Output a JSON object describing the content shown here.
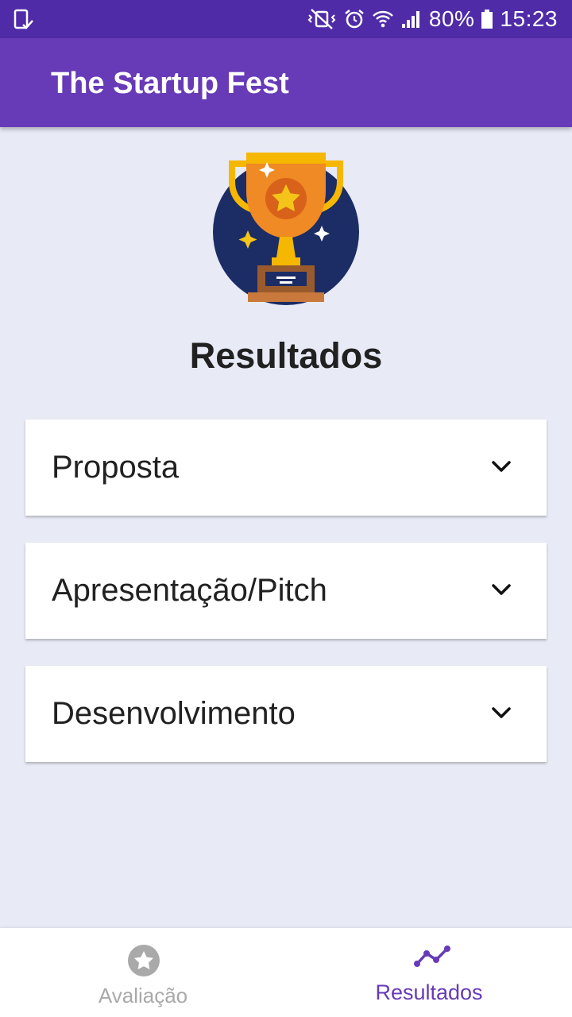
{
  "status_bar": {
    "left_icon": "screenshot-icon",
    "right_icons": [
      "vibrate-mute-icon",
      "alarm-icon",
      "wifi-icon",
      "signal-icon",
      "battery-icon"
    ],
    "battery": "80%",
    "time": "15:23"
  },
  "app_bar": {
    "title": "The Startup Fest"
  },
  "hero": {
    "icon": "trophy-icon"
  },
  "page": {
    "title": "Resultados",
    "sections": [
      {
        "label": "Proposta",
        "icon": "chevron-down-icon",
        "expanded": false
      },
      {
        "label": "Apresentação/Pitch",
        "icon": "chevron-down-icon",
        "expanded": false
      },
      {
        "label": "Desenvolvimento",
        "icon": "chevron-down-icon",
        "expanded": false
      }
    ]
  },
  "bottom_nav": {
    "items": [
      {
        "label": "Avaliação",
        "icon": "star-icon",
        "active": false
      },
      {
        "label": "Resultados",
        "icon": "trend-line-icon",
        "active": true
      }
    ]
  },
  "colors": {
    "status_bar": "#4f2ba8",
    "app_bar": "#673ab7",
    "background": "#e8eaf6",
    "active_nav": "#673ab7",
    "inactive_nav": "#a9a9a9"
  }
}
